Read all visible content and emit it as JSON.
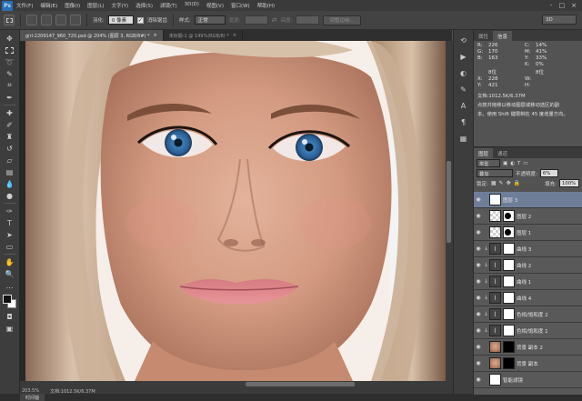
{
  "menubar": {
    "logo": "Ps",
    "items": [
      "文件(F)",
      "编辑(E)",
      "图像(I)",
      "图层(L)",
      "文字(Y)",
      "选择(S)",
      "滤镜(T)",
      "3D(D)",
      "视图(V)",
      "窗口(W)",
      "帮助(H)"
    ],
    "window_buttons": [
      "-",
      "□",
      "×"
    ]
  },
  "optbar": {
    "feather_label": "羽化:",
    "feather_value": "0 像素",
    "antialias_label": "消除锯齿",
    "style_label": "样式:",
    "style_value": "正常",
    "width_label": "宽度:",
    "height_label": "高度:",
    "refine_edge_label": "调整边缘...",
    "workspace": "3D"
  },
  "doc_tabs": [
    {
      "label": "girl-2209147_960_720.psd @ 204% (图层 3, RGB/8#) *",
      "active": true
    },
    {
      "label": "未标题-1 @ 149%(RGB/8) *",
      "active": false
    }
  ],
  "status": {
    "zoom": "203.5%",
    "doc_size": "文档:1012.5K/6.37M"
  },
  "timeline": {
    "label": "时间轴"
  },
  "info_panel": {
    "tabs": [
      "属性",
      "信息"
    ],
    "rows": [
      [
        "R:",
        "226",
        "",
        "C:",
        "14%",
        ""
      ],
      [
        "G:",
        "170",
        "",
        "M:",
        "41%",
        ""
      ],
      [
        "B:",
        "163",
        "",
        "Y:",
        "33%",
        ""
      ],
      [
        "",
        "",
        "",
        "K:",
        "0%",
        ""
      ],
      [
        "",
        "8位",
        "",
        "",
        "8位",
        ""
      ],
      [
        "X:",
        "228",
        "",
        "W:",
        "",
        ""
      ],
      [
        "Y:",
        "421",
        "",
        "H:",
        "",
        ""
      ]
    ],
    "doc_line": "文档:1012.5K/6.37M",
    "hint_line1": "点按并拖移以移动图层或移动选区的副",
    "hint_line2": "本。使用 Shift 键限制在 45 度增量方向。"
  },
  "layers_panel": {
    "tabs": [
      "图层",
      "通道"
    ],
    "filter_kind": "类型",
    "blend_mode": "叠加",
    "opacity_label": "不透明度:",
    "opacity_value": "6%",
    "lock_label": "锁定:",
    "fill_label": "填充:",
    "fill_value": "100%",
    "layers": [
      {
        "name": "图层 3",
        "thumb": "white",
        "mask": false,
        "clip": false,
        "selected": true
      },
      {
        "name": "图层 2",
        "thumb": "checker",
        "mask": true,
        "clip": false,
        "selected": false
      },
      {
        "name": "图层 1",
        "thumb": "checker",
        "mask": true,
        "clip": false,
        "selected": false
      },
      {
        "name": "曲线 3",
        "thumb": "adj",
        "mask": true,
        "clip": true,
        "selected": false
      },
      {
        "name": "曲线 2",
        "thumb": "adj",
        "mask": true,
        "clip": true,
        "selected": false
      },
      {
        "name": "曲线 1",
        "thumb": "adj",
        "mask": true,
        "clip": true,
        "selected": false
      },
      {
        "name": "曲线 4",
        "thumb": "adj",
        "mask": true,
        "clip": true,
        "selected": false
      },
      {
        "name": "色相/饱和度 2",
        "thumb": "adj",
        "mask": true,
        "clip": true,
        "selected": false
      },
      {
        "name": "色相/饱和度 1",
        "thumb": "adj",
        "mask": true,
        "clip": true,
        "selected": false
      },
      {
        "name": "背景 副本 2",
        "thumb": "face",
        "mask": true,
        "clip": false,
        "selected": false
      },
      {
        "name": "背景 副本",
        "thumb": "face",
        "mask": true,
        "clip": false,
        "selected": false
      },
      {
        "name": "智能滤镜",
        "thumb": "white",
        "mask": false,
        "clip": false,
        "selected": false
      }
    ]
  },
  "colors": {
    "accent_selected": "#6e7e99",
    "panel_bg": "#535353",
    "iris": "#3f7fb8"
  }
}
